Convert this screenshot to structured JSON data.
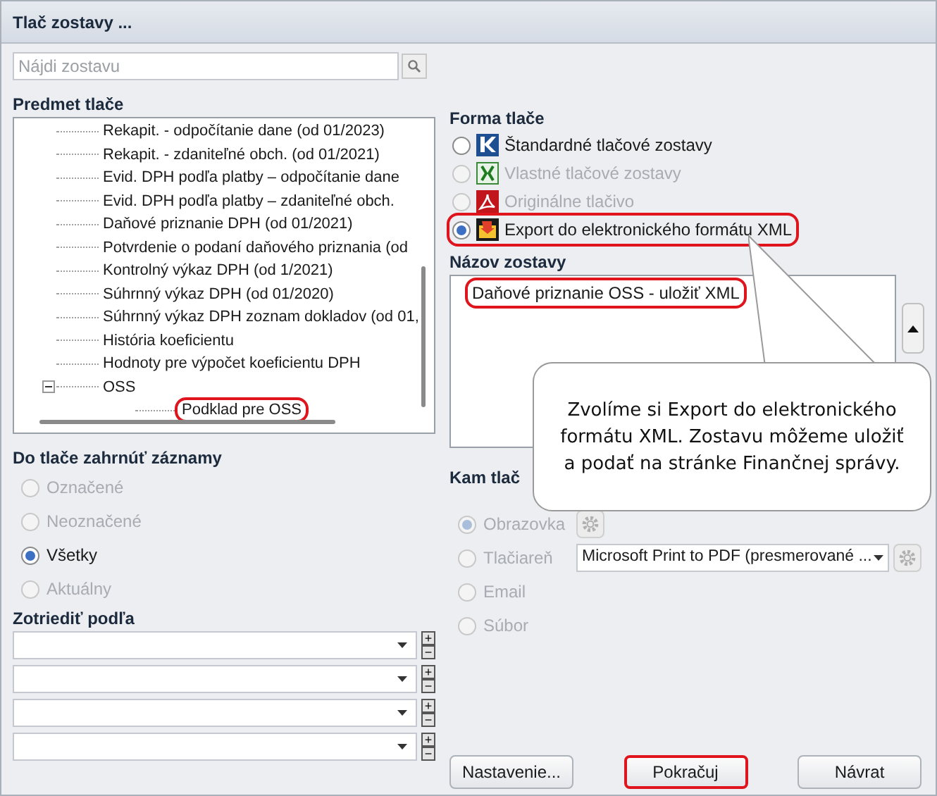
{
  "window": {
    "title": "Tlač zostavy ..."
  },
  "search": {
    "placeholder": "Nájdi zostavu"
  },
  "subject": {
    "heading": "Predmet tlače",
    "items": [
      {
        "label": "Rekapit. - odpočítanie dane (od 01/2023)",
        "highlighted": false
      },
      {
        "label": "Rekapit. - zdaniteľné obch. (od 01/2021)",
        "highlighted": false
      },
      {
        "label": "Evid. DPH podľa platby – odpočítanie dane",
        "highlighted": false
      },
      {
        "label": "Evid. DPH podľa platby – zdaniteľné obch.",
        "highlighted": false
      },
      {
        "label": "Daňové priznanie DPH (od 01/2021)",
        "highlighted": false
      },
      {
        "label": "Potvrdenie o podaní daňového priznania (od",
        "highlighted": false
      },
      {
        "label": "Kontrolný výkaz DPH (od 1/2021)",
        "highlighted": false
      },
      {
        "label": "Súhrnný výkaz DPH (od 01/2020)",
        "highlighted": false
      },
      {
        "label": "Súhrnný výkaz DPH zoznam dokladov (od 01,",
        "highlighted": false
      },
      {
        "label": "História koeficientu",
        "highlighted": false
      },
      {
        "label": "Hodnoty pre výpočet koeficientu DPH",
        "highlighted": false
      },
      {
        "label": "OSS",
        "highlighted": false,
        "expanded": true,
        "children": [
          {
            "label": "Podklad pre OSS",
            "highlighted": true
          }
        ]
      }
    ]
  },
  "form": {
    "heading": "Forma tlače",
    "options": [
      {
        "kind": "kros",
        "label": "Štandardné tlačové zostavy",
        "selected": false,
        "disabled": false,
        "highlighted": false
      },
      {
        "kind": "excel",
        "label": "Vlastné tlačové zostavy",
        "selected": false,
        "disabled": true,
        "highlighted": false
      },
      {
        "kind": "pdf",
        "label": "Originálne tlačivo",
        "selected": false,
        "disabled": true,
        "highlighted": false
      },
      {
        "kind": "xml",
        "label": "Export do elektronického formátu XML",
        "selected": true,
        "disabled": false,
        "highlighted": true
      }
    ]
  },
  "report_name": {
    "heading": "Názov zostavy",
    "items": [
      {
        "label": "Daňové priznanie OSS - uložiť XML",
        "highlighted": true
      }
    ]
  },
  "records": {
    "heading": "Do tlače zahrnúť záznamy",
    "options": [
      {
        "label": "Označené",
        "selected": false,
        "disabled": true
      },
      {
        "label": "Neoznačené",
        "selected": false,
        "disabled": true
      },
      {
        "label": "Všetky",
        "selected": true,
        "disabled": false
      },
      {
        "label": "Aktuálny",
        "selected": false,
        "disabled": true
      }
    ]
  },
  "sort": {
    "heading": "Zotriediť podľa",
    "rows": [
      {
        "buttons": [
          "+",
          "−"
        ]
      },
      {
        "buttons": [
          "+",
          "−"
        ]
      },
      {
        "buttons": [
          "+",
          "−"
        ]
      },
      {
        "buttons": [
          "+",
          "−"
        ]
      }
    ]
  },
  "destination": {
    "heading": "Kam tlač",
    "options": [
      {
        "kind": "gear",
        "label": "Obrazovka",
        "selected": true,
        "disabled": true
      },
      {
        "kind": "printer",
        "label": "Tlačiareň",
        "selected": false,
        "disabled": true,
        "printer": "Microsoft Print to PDF (presmerované ..."
      },
      {
        "kind": "plain",
        "label": "Email",
        "selected": false,
        "disabled": true
      },
      {
        "kind": "plain",
        "label": "Súbor",
        "selected": false,
        "disabled": true
      }
    ]
  },
  "buttons": [
    {
      "label": "Nastavenie...",
      "highlighted": false
    },
    {
      "label": "Pokračuj",
      "highlighted": true
    },
    {
      "label": "Návrat",
      "highlighted": false
    }
  ],
  "callout": {
    "text": "Zvolíme si Export do elektronického formátu XML. Zostavu môžeme uložiť a podať na stránke Finančnej správy."
  }
}
